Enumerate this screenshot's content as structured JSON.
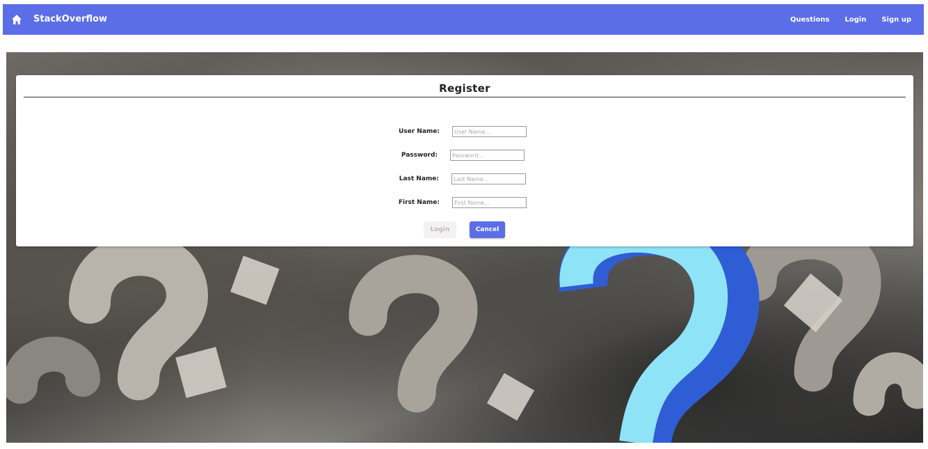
{
  "nav": {
    "brand": "StackOverflow",
    "links": [
      "Questions",
      "Login",
      "Sign up"
    ]
  },
  "form": {
    "title": "Register",
    "fields": [
      {
        "label": "User Name:",
        "placeholder": "User Name...",
        "value": ""
      },
      {
        "label": "Password:",
        "placeholder": "Password...",
        "value": ""
      },
      {
        "label": "Last Name:",
        "placeholder": "Last Name...",
        "value": ""
      },
      {
        "label": "First Name:",
        "placeholder": "First Name...",
        "value": ""
      }
    ],
    "login_label": "Login",
    "cancel_label": "Cancel"
  },
  "colors": {
    "accent": "#5b6ee8",
    "disabled_button": "#f3f1f2"
  },
  "icons": {
    "home": "home-icon"
  }
}
